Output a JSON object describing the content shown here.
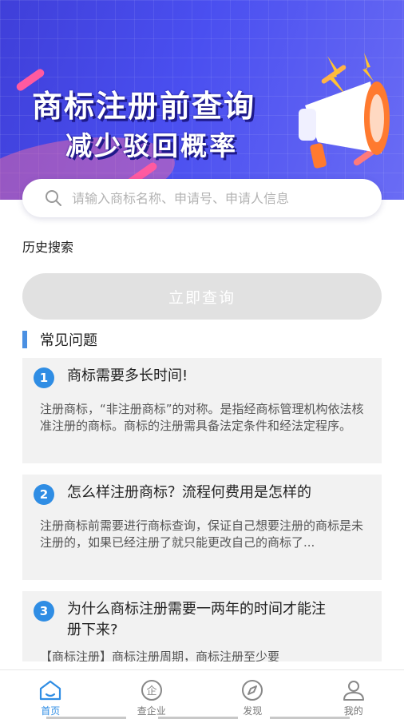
{
  "banner": {
    "title": "商标注册前查询",
    "subtitle": "减少驳回概率"
  },
  "search": {
    "placeholder": "请输入商标名称、申请号、申请人信息",
    "icon": "search-icon"
  },
  "history_label": "历史搜索",
  "query_button": "立即查询",
  "faq": {
    "title": "常见问题",
    "items": [
      {
        "num": "1",
        "question": "商标需要多长时间!",
        "answer": "注册商标，“非注册商标”的对称。是指经商标管理机构依法核准注册的商标。商标的注册需具备法定条件和经法定程序。"
      },
      {
        "num": "2",
        "question": "怎么样注册商标？流程何费用是怎样的",
        "answer": "注册商标前需要进行商标查询，保证自己想要注册的商标是未注册的，如果已经注册了就只能更改自己的商标了..."
      },
      {
        "num": "3",
        "question": "为什么商标注册需要一两年的时间才能注册下来?",
        "answer": "【商标注册】商标注册周期，商标注册至少要"
      }
    ]
  },
  "tabs": [
    {
      "label": "首页",
      "icon": "home-icon",
      "active": true
    },
    {
      "label": "查企业",
      "icon": "enterprise-icon",
      "active": false
    },
    {
      "label": "发现",
      "icon": "compass-icon",
      "active": false
    },
    {
      "label": "我的",
      "icon": "user-icon",
      "active": false
    }
  ],
  "colors": {
    "accent": "#2f8de4",
    "banner": "#4a4ff0",
    "button_disabled": "#e1e1e1"
  }
}
